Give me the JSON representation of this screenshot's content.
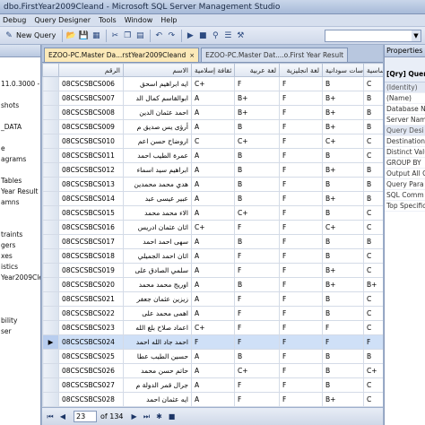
{
  "window": {
    "title": "dbo.FirstYear2009Cleand - Microsoft SQL Server Management Studio"
  },
  "menu": [
    "Debug",
    "Query Designer",
    "Tools",
    "Window",
    "Help"
  ],
  "toolbar": {
    "new_query": "New Query",
    "combo_value": ""
  },
  "left_panel": {
    "rows": [
      "",
      "",
      "11.0.3000 - EZ",
      "",
      "shots",
      "",
      "_DATA",
      "",
      "e",
      "agrams",
      "",
      "Tables",
      "Year Result",
      "amns",
      "",
      "",
      "traints",
      "gers",
      "xes",
      "istics",
      "Year2009Clea",
      "",
      "",
      "",
      "bility",
      "ser"
    ]
  },
  "tabs": [
    {
      "label": "EZOO-PC.Master Da...rstYear2009Cleand",
      "close": "×",
      "active": true
    },
    {
      "label": "EZOO-PC.Master Dat....o.First Year Result",
      "close": "",
      "active": false
    }
  ],
  "grid": {
    "columns": [
      "الرقم",
      "الاسم",
      "ثقافة إسلامية",
      "لغة عربية",
      "لغة انجليزية",
      "دراسات سودانية",
      "رياضيات اساسية"
    ],
    "rows": [
      [
        "08CSCSBCS006",
        "ايه ابراهيم اسحق",
        "C+",
        "F",
        "F",
        "B",
        "C"
      ],
      [
        "08CSCSBCS007",
        "ابوالقاسم كمال الد",
        "A",
        "B+",
        "F",
        "B+",
        "B"
      ],
      [
        "08CSCSBCS008",
        "احمد عثمان الدين",
        "A",
        "B+",
        "F",
        "B+",
        "B"
      ],
      [
        "08CSCSBCS009",
        "أرؤى يس صديق م",
        "A",
        "B",
        "F",
        "B+",
        "B"
      ],
      [
        "08CSCSBCS010",
        "اروضاح حسن اعم",
        "C",
        "C+",
        "F",
        "C+",
        "C"
      ],
      [
        "08CSCSBCS011",
        "عمرة الطيب احمد",
        "A",
        "B",
        "F",
        "B",
        "C"
      ],
      [
        "08CSCSBCS012",
        "ابراهيم سيد اسماء",
        "A",
        "B",
        "F",
        "B+",
        "B"
      ],
      [
        "08CSCSBCS013",
        "هدي محمد محمدين",
        "A",
        "B",
        "F",
        "B",
        "B"
      ],
      [
        "08CSCSBCS014",
        "عبير عيسى عبد",
        "A",
        "B",
        "F",
        "B+",
        "B"
      ],
      [
        "08CSCSBCS015",
        "الاء محمد محمد",
        "A",
        "C+",
        "F",
        "B",
        "C"
      ],
      [
        "08CSCSBCS016",
        "اثان عثمان ادريس",
        "C+",
        "F",
        "F",
        "C+",
        "C"
      ],
      [
        "08CSCSBCS017",
        "سهى احمد احمد",
        "A",
        "B",
        "F",
        "B",
        "B"
      ],
      [
        "08CSCSBCS018",
        "اثان احمد الجميلي",
        "A",
        "F",
        "F",
        "B",
        "C"
      ],
      [
        "08CSCSBCS019",
        "سلمي الصادق على",
        "A",
        "F",
        "F",
        "B+",
        "C"
      ],
      [
        "08CSCSBCS020",
        "اوريج محمد محمد",
        "A",
        "B",
        "F",
        "B+",
        "B+"
      ],
      [
        "08CSCSBCS021",
        "زيزين عثمان جعفر",
        "A",
        "F",
        "F",
        "B",
        "C"
      ],
      [
        "08CSCSBCS022",
        "اهمى محمد على",
        "A",
        "F",
        "F",
        "B",
        "C"
      ],
      [
        "08CSCSBCS023",
        "اعماد صلاح بلغ الله",
        "C+",
        "F",
        "F",
        "F",
        "C"
      ],
      [
        "08CSCSBCS024",
        "احمد جاد الله احمد",
        "F",
        "F",
        "F",
        "F",
        "F"
      ],
      [
        "08CSCSBCS025",
        "حسين الطيب عطا",
        "A",
        "B",
        "F",
        "B",
        "B"
      ],
      [
        "08CSCSBCS026",
        "حاتم حسن محمد",
        "A",
        "C+",
        "F",
        "B",
        "C+"
      ],
      [
        "08CSCSBCS027",
        "جرال قمر الدولة م",
        "A",
        "F",
        "F",
        "B",
        "C"
      ],
      [
        "08CSCSBCS028",
        "ايه عثمان احمد",
        "A",
        "F",
        "F",
        "B+",
        "C"
      ],
      [
        "08CSCSBCS029",
        "اكرم عثمان عبد",
        "A",
        "F",
        "F",
        "B",
        "C"
      ]
    ],
    "current_row_index": 18,
    "current_marker": "▶"
  },
  "navigator": {
    "current": "23",
    "of_label": "of 134"
  },
  "properties": {
    "header": "Properties",
    "sub": "[Qry] Query1.dtq",
    "rows": [
      {
        "label": "(Identity)",
        "cat": true
      },
      {
        "label": "(Name)",
        "cat": false
      },
      {
        "label": "Database N",
        "cat": false
      },
      {
        "label": "Server Nam",
        "cat": false
      },
      {
        "label": "Query Desi",
        "cat": true
      },
      {
        "label": "Destination",
        "cat": false
      },
      {
        "label": "Distinct Valu",
        "cat": false
      },
      {
        "label": "GROUP BY",
        "cat": false
      },
      {
        "label": "Output All C",
        "cat": false
      },
      {
        "label": "Query Para",
        "cat": false
      },
      {
        "label": "SQL Comm",
        "cat": false
      },
      {
        "label": "Top Specific",
        "cat": false
      }
    ]
  },
  "icons": [
    "new-query-icon",
    "open-icon",
    "save-icon",
    "undo-icon",
    "redo-icon",
    "nav-first-icon",
    "nav-prev-icon",
    "nav-next-icon",
    "nav-last-icon",
    "nav-new-icon",
    "stop-icon"
  ]
}
